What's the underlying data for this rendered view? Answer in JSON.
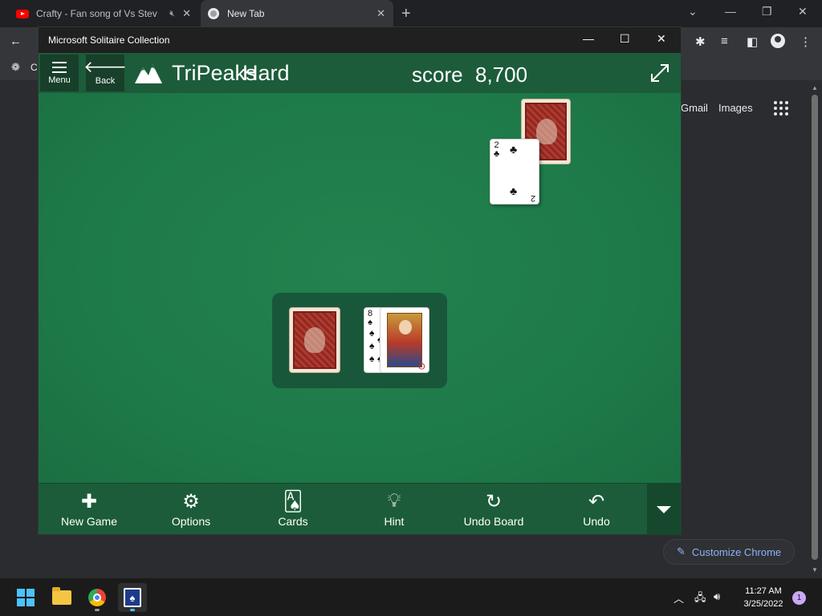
{
  "browser": {
    "tabs": [
      {
        "title": "Crafty - Fan song of Vs Stev",
        "icon": "youtube-icon",
        "muted_icon": "speaker-muted-icon"
      },
      {
        "title": "New Tab",
        "icon": "chrome-icon"
      }
    ],
    "bookmark_label": "Ca",
    "ntp_links": {
      "gmail": "Gmail",
      "images": "Images"
    },
    "customize_label": "Customize Chrome",
    "colors": {
      "background": "#202124",
      "link": "#8ab4f8"
    }
  },
  "solitaire": {
    "window_title": "Microsoft Solitaire Collection",
    "header": {
      "menu_label": "Menu",
      "back_label": "Back",
      "game_name": "TriPeaks",
      "difficulty": "Hard",
      "score_label": "score",
      "score_value": "8,700"
    },
    "board": {
      "face_up_card": {
        "rank": "2",
        "suit": "♣"
      },
      "waste_card_back": {
        "rank": "8",
        "suit": "♠"
      },
      "waste_card_top": {
        "rank": "Q",
        "suit": "♥",
        "rank_shown": "Q"
      }
    },
    "toolbar": {
      "new_game": "New Game",
      "options": "Options",
      "cards": "Cards",
      "hint": "Hint",
      "undo_board": "Undo Board",
      "undo": "Undo"
    },
    "colors": {
      "felt": "#1f7a4e",
      "header": "#1c5c3a",
      "card_back": "#b23a2f"
    }
  },
  "taskbar": {
    "time": "11:27 AM",
    "date": "3/25/2022",
    "notification_count": "1"
  }
}
